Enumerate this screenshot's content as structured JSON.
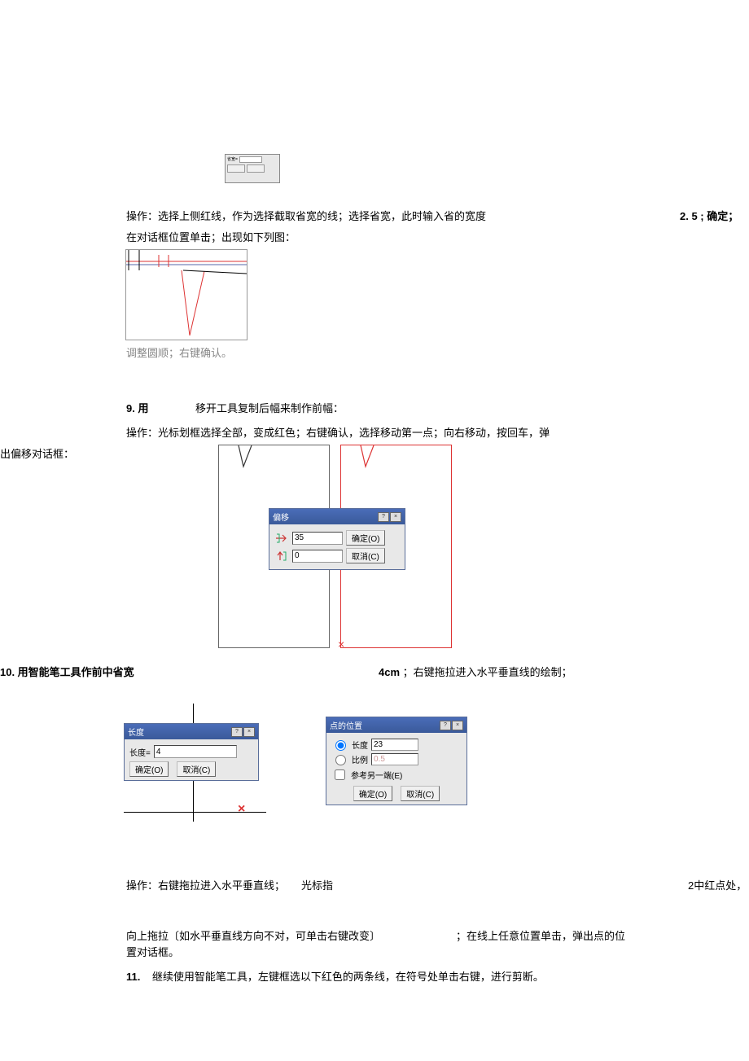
{
  "mini_dialog": {
    "label": "省宽=",
    "value": "2.5",
    "ok": "确定",
    "cancel": "取消(C)"
  },
  "para1": {
    "line1a": "操作：选择上侧红线，作为选择截取省宽的线；选择省宽，此时输入省的宽度",
    "line1b": "2. 5 ; 确定；",
    "line2": "在对话框位置单击；出现如下列图：",
    "caption": "调整圆顺；右键确认。"
  },
  "step9": {
    "num": "9. 用",
    "title": "移开工具复制后幅来制作前幅：",
    "op1": "操作：光标划框选择全部，变成红色；右键确认，选择移动第一点；向右移动，按回车，弹",
    "op2": "出偏移对话框："
  },
  "offset_dialog": {
    "title": "偏移",
    "x": "35",
    "y": "0",
    "ok": "确定(O)",
    "cancel": "取消(C)"
  },
  "step10": {
    "left": "10. 用智能笔工具作前中省宽",
    "mid": "4cm",
    "right": "；右键拖拉进入水平垂直线的绘制；"
  },
  "length_dialog": {
    "title": "长度",
    "label": "长度=",
    "value": "4",
    "ok": "确定(O)",
    "cancel": "取消(C)"
  },
  "point_dialog": {
    "title": "点的位置",
    "len_label": "长度",
    "len_value": "23",
    "ratio_label": "比例",
    "ratio_value": "0.5",
    "ref_label": "参考另一端(E)",
    "ok": "确定(O)",
    "cancel": "取消(C)"
  },
  "para_after10": {
    "line1a": "操作：右键拖拉进入水平垂直线；",
    "line1b": "光标指",
    "line1c": "2中红点处，",
    "line2": "向上拖拉〔如水平垂直线方向不对，可单击右键改变〕",
    "line2b": "；在线上任意位置单击，弹出点的位",
    "line3": "置对话框。"
  },
  "step11": {
    "num": "11.",
    "text": "继续使用智能笔工具，左键框选以下红色的两条线，在符号处单击右键，进行剪断。"
  }
}
